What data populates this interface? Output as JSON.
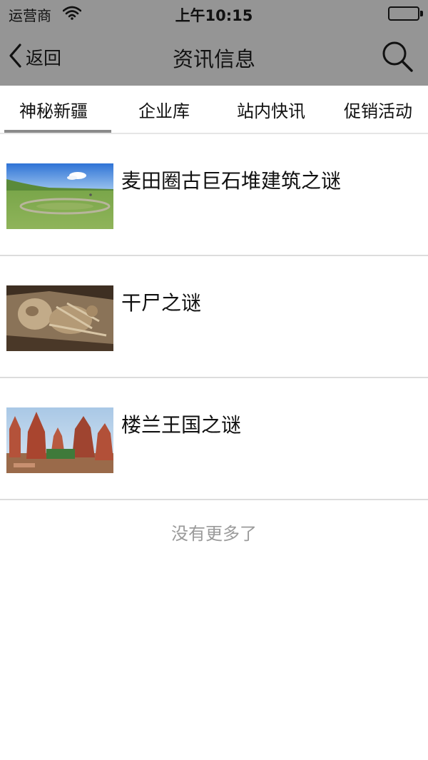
{
  "status_bar": {
    "carrier": "运营商",
    "time": "上午10:15",
    "battery_level": 1.0
  },
  "nav": {
    "back_label": "返回",
    "title": "资讯信息",
    "icons": {
      "back": "chevron-left-icon",
      "search": "search-icon"
    }
  },
  "tabs": [
    {
      "label": "神秘新疆",
      "active": true
    },
    {
      "label": "企业库",
      "active": false
    },
    {
      "label": "站内快讯",
      "active": false
    },
    {
      "label": "促销活动",
      "active": false
    }
  ],
  "articles": [
    {
      "title": "麦田圈古巨石堆建筑之谜",
      "image": "grassland-stone-circle-photo"
    },
    {
      "title": "干尸之谜",
      "image": "mummy-photo"
    },
    {
      "title": "楼兰王国之谜",
      "image": "ancient-temples-photo"
    }
  ],
  "footer": {
    "no_more": "没有更多了"
  },
  "colors": {
    "nav_background": "#959595",
    "active_tab_underline": "#8a8a8a",
    "divider": "#dcdcdc",
    "muted_text": "#9a9a9a"
  }
}
